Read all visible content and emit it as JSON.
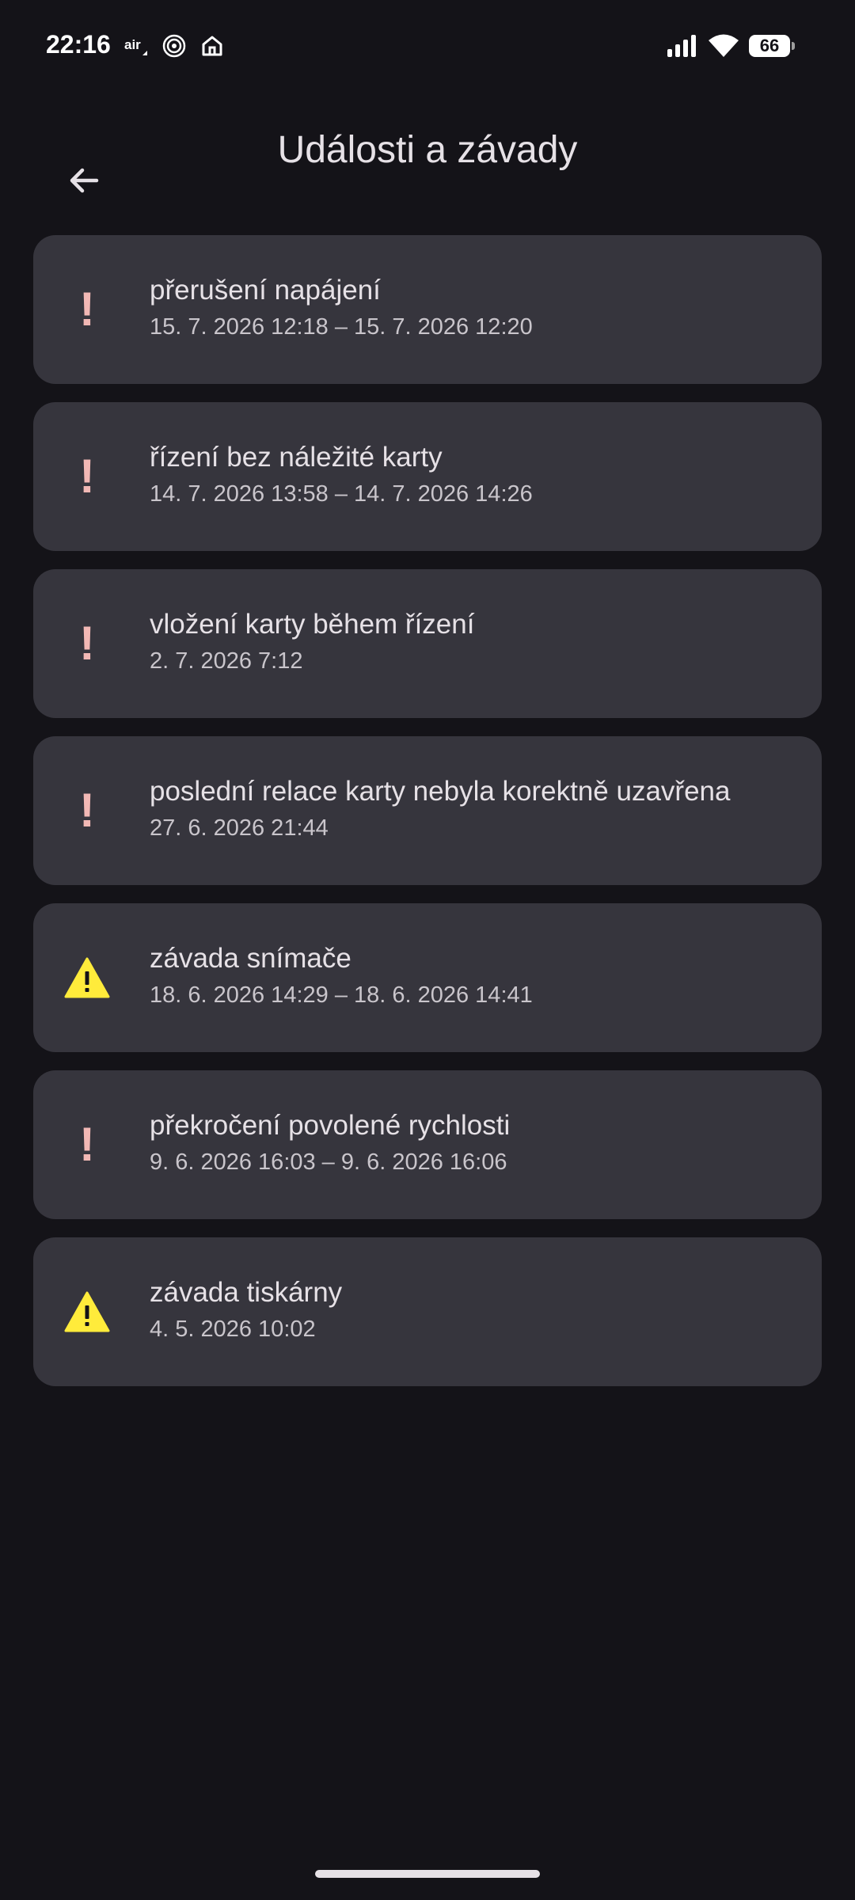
{
  "status_bar": {
    "time": "22:16",
    "left_icons": [
      "air-icon",
      "nfc-icon",
      "home-icon"
    ],
    "right_icons": [
      "signal-icon",
      "wifi-icon",
      "battery-icon"
    ],
    "battery_level": "66"
  },
  "app_bar": {
    "back_icon": "arrow-back-icon",
    "title": "Události a závady"
  },
  "colors": {
    "background": "#141318",
    "card": "#36353d",
    "error_icon": "#f2b8b5",
    "warning_icon": "#ffeb3b"
  },
  "events": [
    {
      "icon": "exclamation-icon",
      "title": "přerušení napájení",
      "time": "15. 7. 2026 12:18 – 15. 7. 2026 12:20"
    },
    {
      "icon": "exclamation-icon",
      "title": "řízení bez náležité karty",
      "time": "14. 7. 2026 13:58 – 14. 7. 2026 14:26"
    },
    {
      "icon": "exclamation-icon",
      "title": "vložení karty během řízení",
      "time": "2. 7. 2026 7:12"
    },
    {
      "icon": "exclamation-icon",
      "title": "poslední relace karty nebyla korektně uzavřena",
      "time": "27. 6. 2026 21:44"
    },
    {
      "icon": "warning-icon",
      "title": "závada snímače",
      "time": "18. 6. 2026 14:29 – 18. 6. 2026 14:41"
    },
    {
      "icon": "exclamation-icon",
      "title": "překročení povolené rychlosti",
      "time": "9. 6. 2026 16:03 – 9. 6. 2026 16:06"
    },
    {
      "icon": "warning-icon",
      "title": "závada tiskárny",
      "time": "4. 5. 2026 10:02"
    }
  ]
}
